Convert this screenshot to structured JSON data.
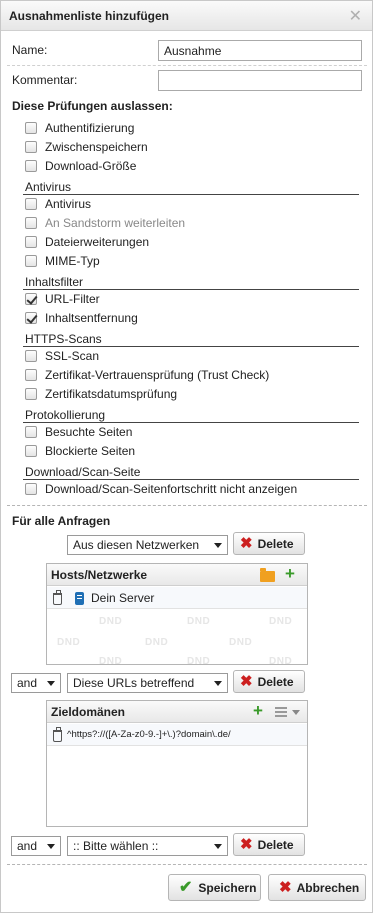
{
  "dialog": {
    "title": "Ausnahmenliste hinzufügen",
    "close_glyph": "✕"
  },
  "form": {
    "name_label": "Name:",
    "name_value": "Ausnahme",
    "comment_label": "Kommentar:",
    "comment_value": ""
  },
  "skip": {
    "title": "Diese Prüfungen auslassen:",
    "general": [
      {
        "label": "Authentifizierung",
        "checked": false
      },
      {
        "label": "Zwischenspeichern",
        "checked": false
      },
      {
        "label": "Download-Größe",
        "checked": false
      }
    ],
    "antivirus": {
      "label": "Antivirus",
      "items": [
        {
          "label": "Antivirus",
          "checked": false
        },
        {
          "label": "An Sandstorm weiterleiten",
          "checked": false,
          "disabled": true
        },
        {
          "label": "Dateierweiterungen",
          "checked": false
        },
        {
          "label": "MIME-Typ",
          "checked": false
        }
      ]
    },
    "content_filter": {
      "label": "Inhaltsfilter",
      "items": [
        {
          "label": "URL-Filter",
          "checked": true
        },
        {
          "label": "Inhaltsentfernung",
          "checked": true
        }
      ]
    },
    "https": {
      "label": "HTTPS-Scans",
      "items": [
        {
          "label": "SSL-Scan",
          "checked": false
        },
        {
          "label": "Zertifikat-Vertrauensprüfung (Trust Check)",
          "checked": false
        },
        {
          "label": "Zertifikatsdatumsprüfung",
          "checked": false
        }
      ]
    },
    "logging": {
      "label": "Protokollierung",
      "items": [
        {
          "label": "Besuchte Seiten",
          "checked": false
        },
        {
          "label": "Blockierte Seiten",
          "checked": false
        }
      ]
    },
    "download_page": {
      "label": "Download/Scan-Seite",
      "items": [
        {
          "label": "Download/Scan-Seitenfortschritt nicht anzeigen",
          "checked": false
        }
      ]
    }
  },
  "requests": {
    "title": "Für alle Anfragen",
    "rule1": {
      "select": "Aus diesen Netzwerken",
      "delete": "Delete"
    },
    "hosts_panel": {
      "title": "Hosts/Netzwerke",
      "items": [
        "Dein Server"
      ],
      "dnd": "DND"
    },
    "rule2": {
      "op": "and",
      "select": "Diese URLs betreffend",
      "delete": "Delete"
    },
    "domains_panel": {
      "title": "Zieldomänen",
      "items": [
        "^https?://([A-Za-z0-9.-]+\\.)?domain\\.de/"
      ]
    },
    "rule3": {
      "op": "and",
      "select": ":: Bitte wählen ::",
      "delete": "Delete"
    }
  },
  "footer": {
    "save": "Speichern",
    "cancel": "Abbrechen"
  },
  "colors": {
    "accept_green": "#3a9a2a",
    "cancel_red": "#cc1f1f",
    "folder_orange": "#f0a020",
    "server_blue": "#1f6fb5"
  }
}
